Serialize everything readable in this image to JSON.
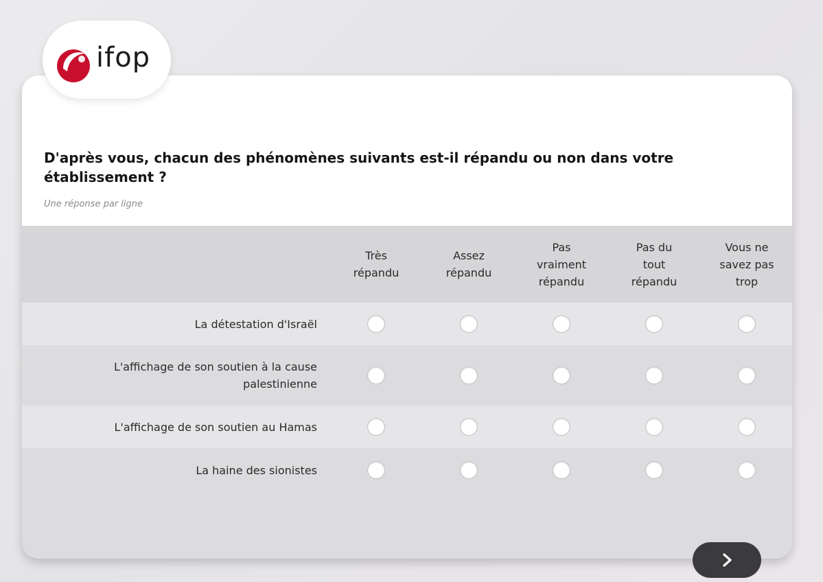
{
  "brand": {
    "logo_text": "ifop",
    "accent_color": "#c8102e"
  },
  "survey": {
    "question": "D'après vous, chacun des phénomènes suivants est-il répandu ou non dans votre établissement ?",
    "instruction": "Une réponse par ligne",
    "columns": [
      {
        "label": "Très\nrépandu"
      },
      {
        "label": "Assez\nrépandu"
      },
      {
        "label": "Pas\nvraiment\nrépandu"
      },
      {
        "label": "Pas du\ntout\nrépandu"
      },
      {
        "label": "Vous ne\nsavez pas\ntrop"
      }
    ],
    "rows": [
      {
        "label": "La détestation d'Israël"
      },
      {
        "label": "L'affichage de son soutien à la cause palestinienne"
      },
      {
        "label": "L'affichage de son soutien au Hamas"
      },
      {
        "label": "La haine des sionistes"
      }
    ]
  },
  "navigation": {
    "next_icon": "chevron-right-icon"
  }
}
